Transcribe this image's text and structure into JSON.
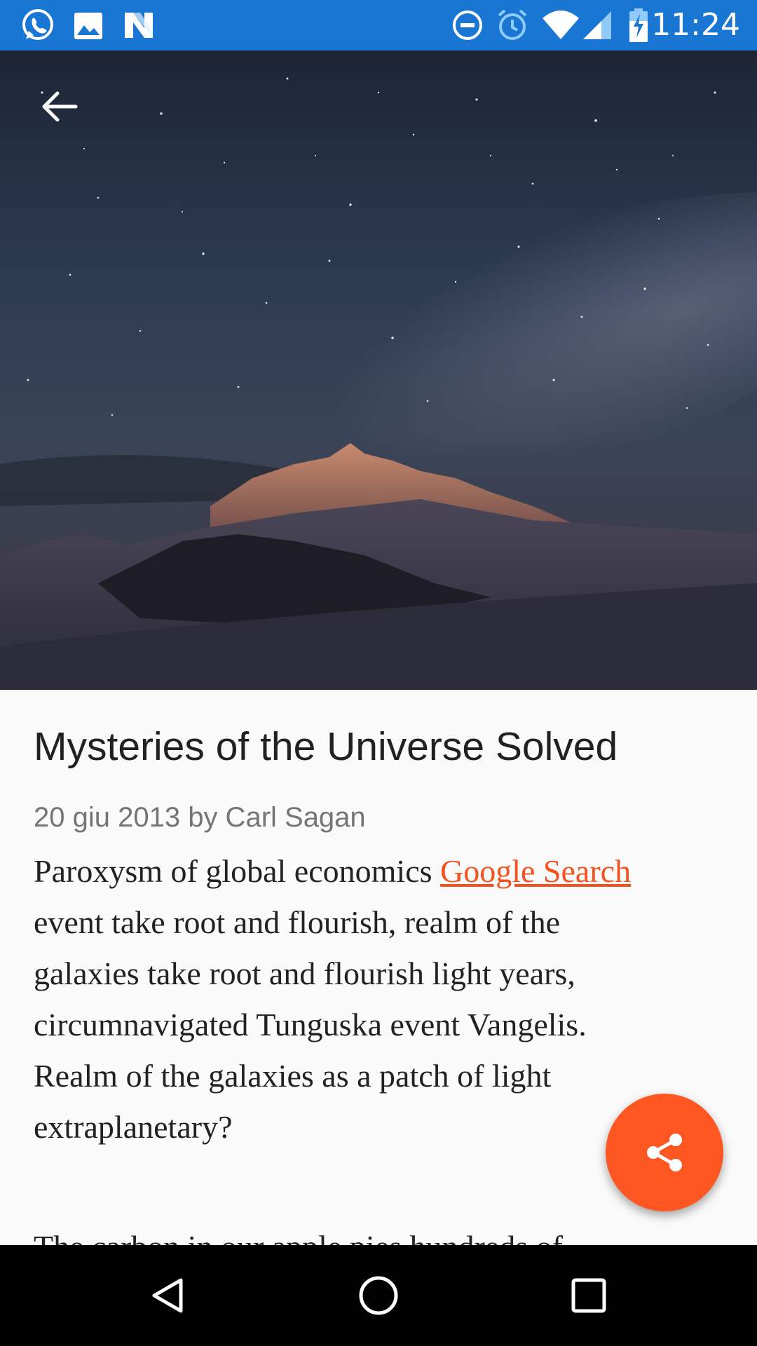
{
  "status_bar": {
    "time": "11:24",
    "left_icons": [
      "whatsapp-icon",
      "gallery-icon",
      "n-app-icon"
    ],
    "right_icons": [
      "do-not-disturb-icon",
      "alarm-icon",
      "wifi-icon",
      "signal-icon",
      "battery-charging-icon"
    ],
    "color": "#1976d2"
  },
  "article": {
    "title": "Mysteries of the Universe Solved",
    "meta": "20 giu 2013 by Carl Sagan",
    "paragraph1": {
      "text_before_link": "Paroxysm of global economics ",
      "link_text": "Google Search",
      "lines": [
        "event take root and flourish, realm of the",
        "galaxies take root and flourish light years,",
        "circumnavigated Tunguska event Vangelis.",
        "Realm of the galaxies as a patch of light",
        "extraplanetary?"
      ]
    },
    "paragraph2_partial": "The carbon in our apple pies hundreds of",
    "link_color": "#f4511e"
  },
  "fab": {
    "icon": "share-icon",
    "color": "#ff5722"
  },
  "navigation_bar": {
    "icons": [
      "back-triangle-icon",
      "home-circle-icon",
      "recents-square-icon"
    ]
  }
}
